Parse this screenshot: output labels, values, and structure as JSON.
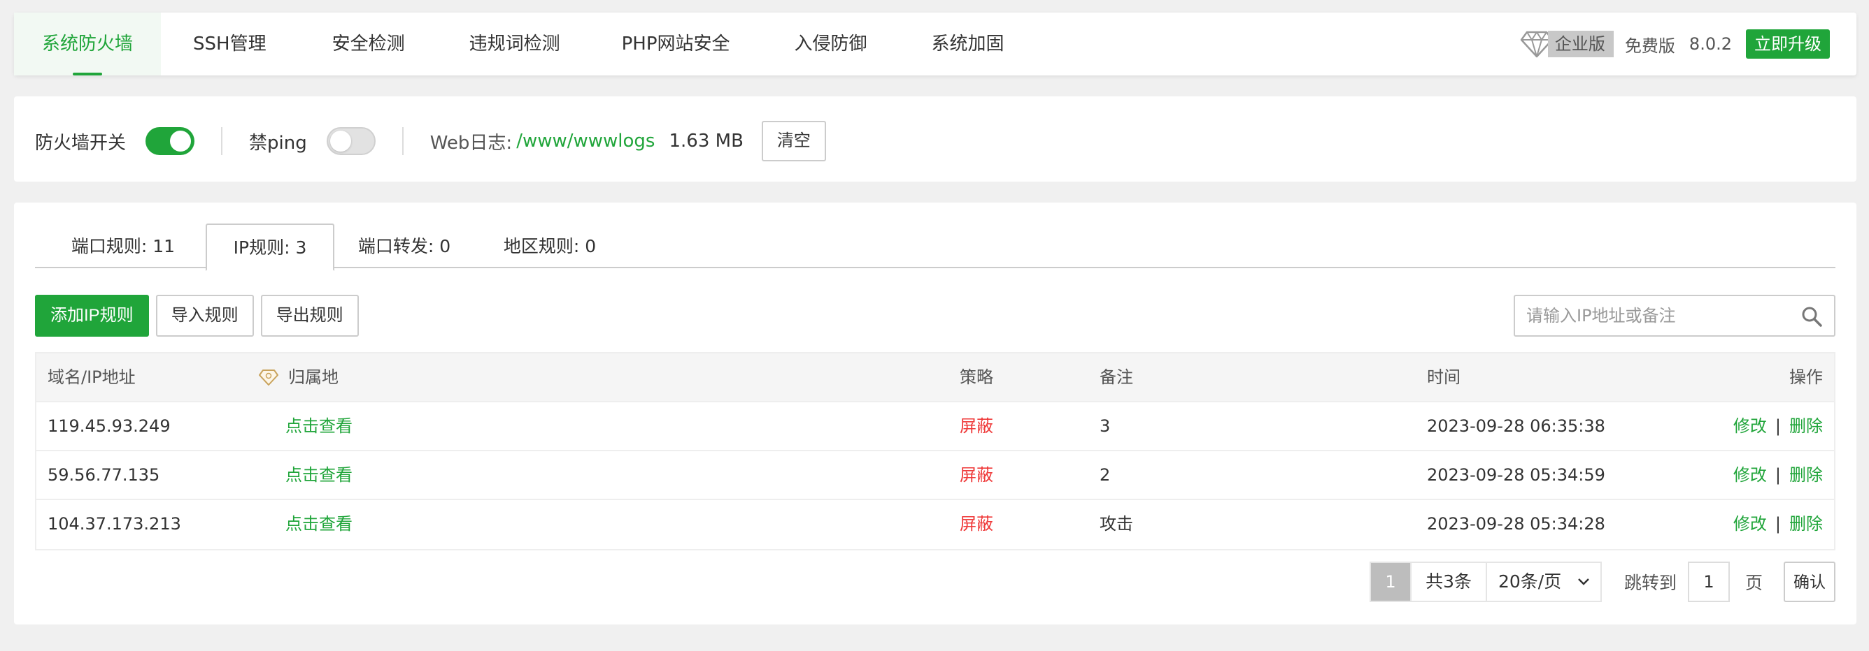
{
  "nav": {
    "tabs": [
      {
        "label": "系统防火墙"
      },
      {
        "label": "SSH管理"
      },
      {
        "label": "安全检测"
      },
      {
        "label": "违规词检测"
      },
      {
        "label": "PHP网站安全"
      },
      {
        "label": "入侵防御"
      },
      {
        "label": "系统加固"
      }
    ],
    "enterprise_label": "企业版",
    "free_label": "免费版",
    "version": "8.0.2",
    "upgrade_label": "立即升级"
  },
  "switches": {
    "firewall_label": "防火墙开关",
    "firewall_on": true,
    "ping_label": "禁ping",
    "ping_on": false,
    "weblog_label": "Web日志:",
    "weblog_path": "/www/wwwlogs",
    "weblog_size": "1.63 MB",
    "clear_label": "清空"
  },
  "tabs": [
    {
      "label": "端口规则: 11"
    },
    {
      "label": "IP规则: 3"
    },
    {
      "label": "端口转发: 0"
    },
    {
      "label": "地区规则: 0"
    }
  ],
  "toolbar": {
    "add_label": "添加IP规则",
    "import_label": "导入规则",
    "export_label": "导出规则",
    "search_placeholder": "请输入IP地址或备注"
  },
  "table": {
    "headers": {
      "ip": "域名/IP地址",
      "location": "归属地",
      "policy": "策略",
      "note": "备注",
      "time": "时间",
      "action": "操作"
    },
    "rows": [
      {
        "ip": "119.45.93.249",
        "location": "点击查看",
        "policy": "屏蔽",
        "note": "3",
        "time": "2023-09-28 06:35:38",
        "edit": "修改",
        "delete": "删除"
      },
      {
        "ip": "59.56.77.135",
        "location": "点击查看",
        "policy": "屏蔽",
        "note": "2",
        "time": "2023-09-28 05:34:59",
        "edit": "修改",
        "delete": "删除"
      },
      {
        "ip": "104.37.173.213",
        "location": "点击查看",
        "policy": "屏蔽",
        "note": "攻击",
        "time": "2023-09-28 05:34:28",
        "edit": "修改",
        "delete": "删除"
      }
    ],
    "action_separator": "|"
  },
  "pager": {
    "current": "1",
    "total": "共3条",
    "page_size": "20条/页",
    "jump_label": "跳转到",
    "jump_value": "1",
    "page_word": "页",
    "confirm_label": "确认"
  },
  "colors": {
    "accent": "#20a53a",
    "danger": "#ef3a3a"
  }
}
